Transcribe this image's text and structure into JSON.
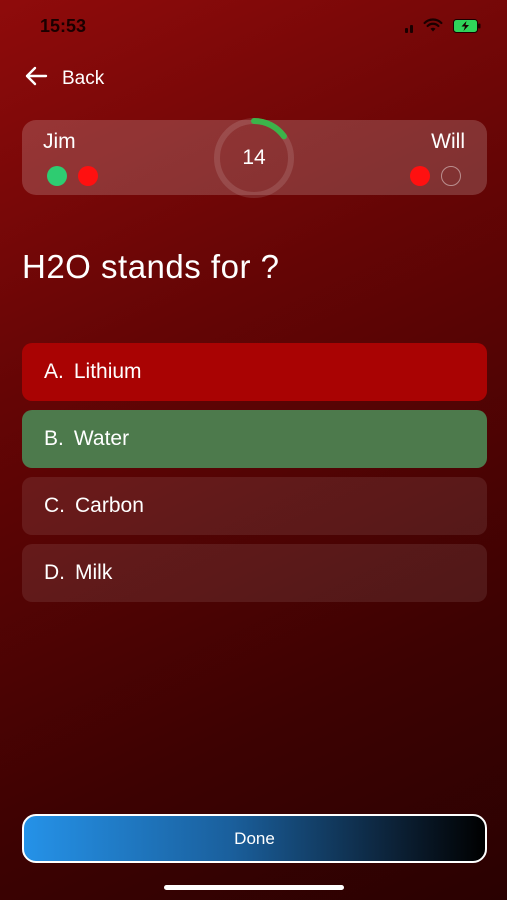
{
  "status_bar": {
    "time": "15:53"
  },
  "header": {
    "back_label": "Back",
    "back_icon": "arrow-left-icon"
  },
  "score_card": {
    "player_left": {
      "name": "Jim",
      "results": [
        "correct",
        "wrong"
      ]
    },
    "player_right": {
      "name": "Will",
      "results": [
        "wrong",
        "pending"
      ]
    },
    "timer": {
      "value": "14",
      "progress": 0.15
    }
  },
  "question": {
    "text": "H2O stands for ?"
  },
  "options": [
    {
      "letter": "A.",
      "label": "Lithium",
      "state": "wrong"
    },
    {
      "letter": "B.",
      "label": "Water",
      "state": "correct"
    },
    {
      "letter": "C.",
      "label": "Carbon",
      "state": "neutral"
    },
    {
      "letter": "D.",
      "label": "Milk",
      "state": "neutral"
    }
  ],
  "done_button": {
    "label": "Done"
  },
  "colors": {
    "correct": "#2ecc71",
    "wrong": "#ff1010",
    "option_wrong_bg": "#a90303",
    "option_correct_bg": "#4d7a4c",
    "timer_accent": "#3cb44a"
  }
}
